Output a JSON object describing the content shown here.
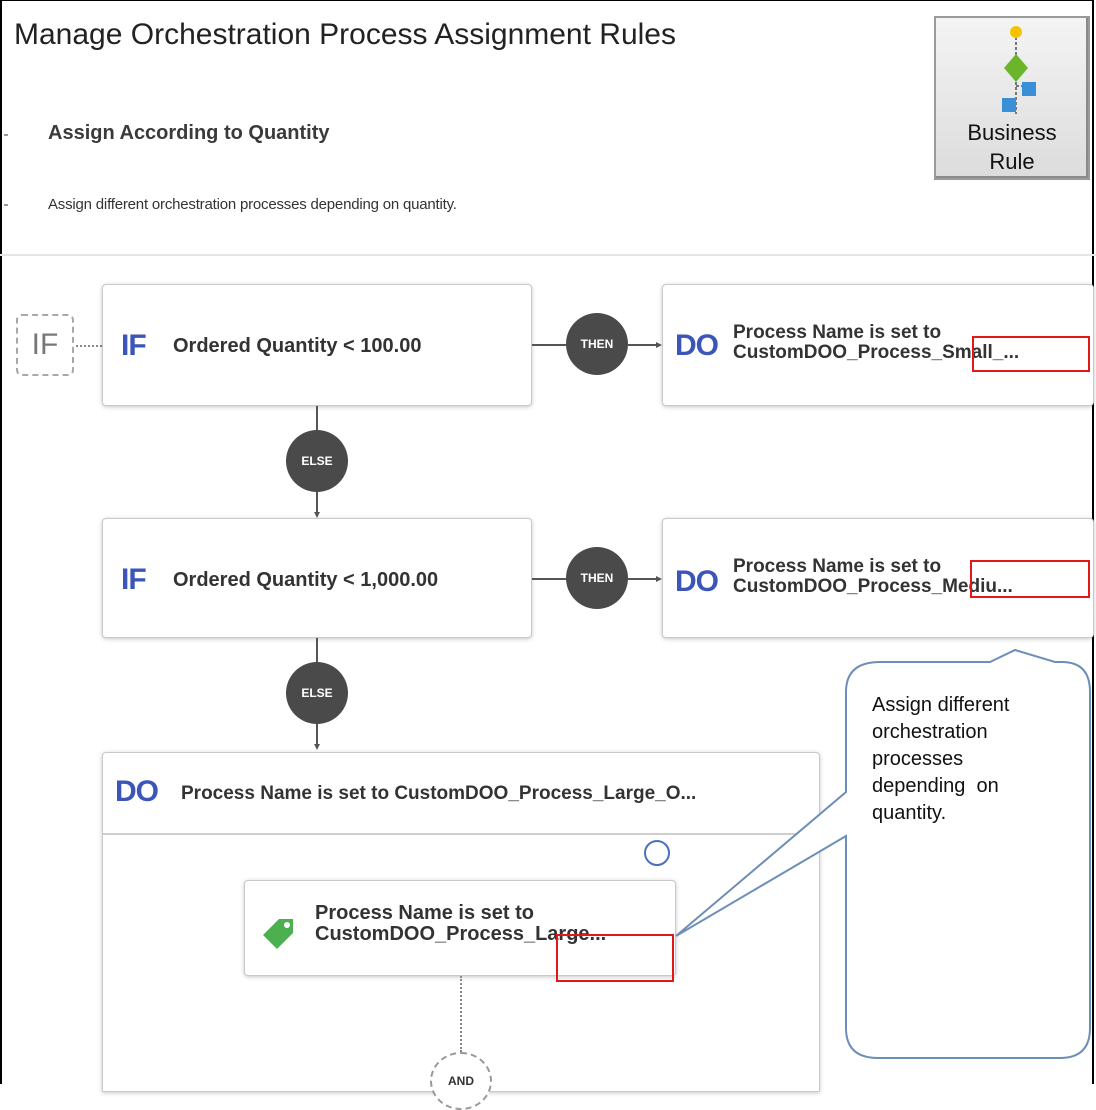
{
  "page": {
    "title": "Manage Orchestration Process Assignment Rules",
    "section_title": "Assign According to Quantity",
    "section_description": "Assign different orchestration processes depending on quantity."
  },
  "business_rule_button": {
    "label_line1": "Business",
    "label_line2": "Rule",
    "icon": "business-rule-flowchart-icon"
  },
  "rule_flow": {
    "if_badge": "IF",
    "then_label": "THEN",
    "else_label": "ELSE",
    "and_label": "AND",
    "if_keyword": "IF",
    "do_keyword": "DO",
    "conditions": [
      {
        "condition": "Ordered Quantity < 100.00",
        "action_line1": "Process Name is set to",
        "action_line2": "CustomDOO_Process_Small_..."
      },
      {
        "condition": "Ordered Quantity < 1,000.00",
        "action_line1": "Process Name is set to",
        "action_line2": "CustomDOO_Process_Mediu..."
      }
    ],
    "else_action": {
      "header": "Process Name is set to CustomDOO_Process_Large_O...",
      "detail_line1": "Process Name is set to",
      "detail_line2": "CustomDOO_Process_Large...",
      "tag_icon": "tag-icon",
      "tag_color": "#4caf50"
    }
  },
  "callout": {
    "lines": [
      "Assign different",
      "orchestration",
      "processes",
      "depending  on",
      "quantity."
    ]
  },
  "colors": {
    "keyword_blue": "#3b55b8",
    "highlight_red": "#e01818",
    "connector_gray": "#4a4a4a"
  }
}
